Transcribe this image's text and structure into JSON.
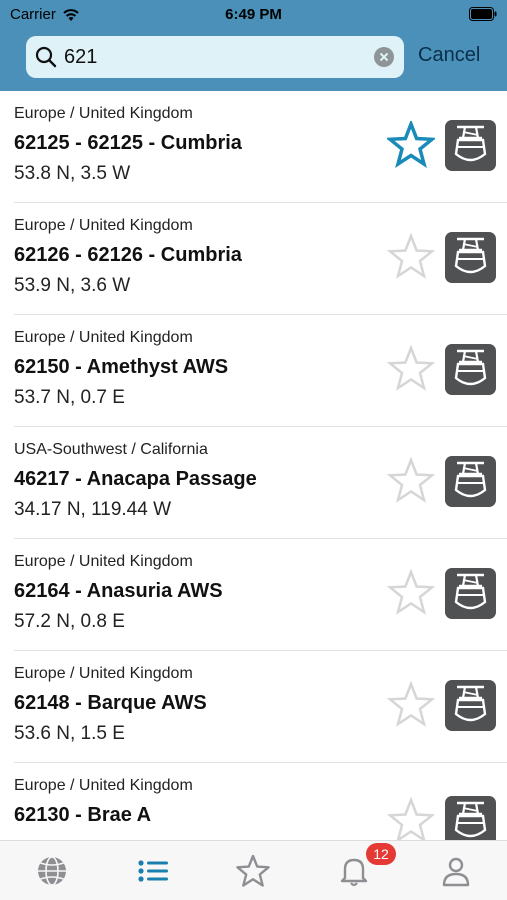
{
  "status_bar": {
    "carrier": "Carrier",
    "time": "6:49 PM"
  },
  "search": {
    "query": "621",
    "cancel_label": "Cancel"
  },
  "colors": {
    "header": "#4a90b8",
    "accent": "#1a8ab8",
    "star_inactive": "#d6d6d6",
    "badge": "#e53935"
  },
  "stations": [
    {
      "region": "Europe / United Kingdom",
      "name": "62125 - 62125 - Cumbria",
      "coords": "53.8 N, 3.5 W",
      "favorite": true
    },
    {
      "region": "Europe / United Kingdom",
      "name": "62126 - 62126 - Cumbria",
      "coords": "53.9 N, 3.6 W",
      "favorite": false
    },
    {
      "region": "Europe / United Kingdom",
      "name": "62150 - Amethyst AWS",
      "coords": "53.7 N, 0.7 E",
      "favorite": false
    },
    {
      "region": "USA-Southwest / California",
      "name": "46217 - Anacapa Passage",
      "coords": "34.17 N, 119.44 W",
      "favorite": false
    },
    {
      "region": "Europe / United Kingdom",
      "name": "62164 - Anasuria AWS",
      "coords": "57.2 N, 0.8 E",
      "favorite": false
    },
    {
      "region": "Europe / United Kingdom",
      "name": "62148 - Barque AWS",
      "coords": "53.6 N, 1.5 E",
      "favorite": false
    },
    {
      "region": "Europe / United Kingdom",
      "name": "62130 - Brae A",
      "coords": "",
      "favorite": false
    }
  ],
  "tabbar": {
    "tabs": [
      {
        "icon": "globe-icon",
        "active": false
      },
      {
        "icon": "list-icon",
        "active": true
      },
      {
        "icon": "star-icon",
        "active": false
      },
      {
        "icon": "bell-icon",
        "active": false
      },
      {
        "icon": "person-icon",
        "active": false
      }
    ],
    "notifications_badge": "12"
  }
}
